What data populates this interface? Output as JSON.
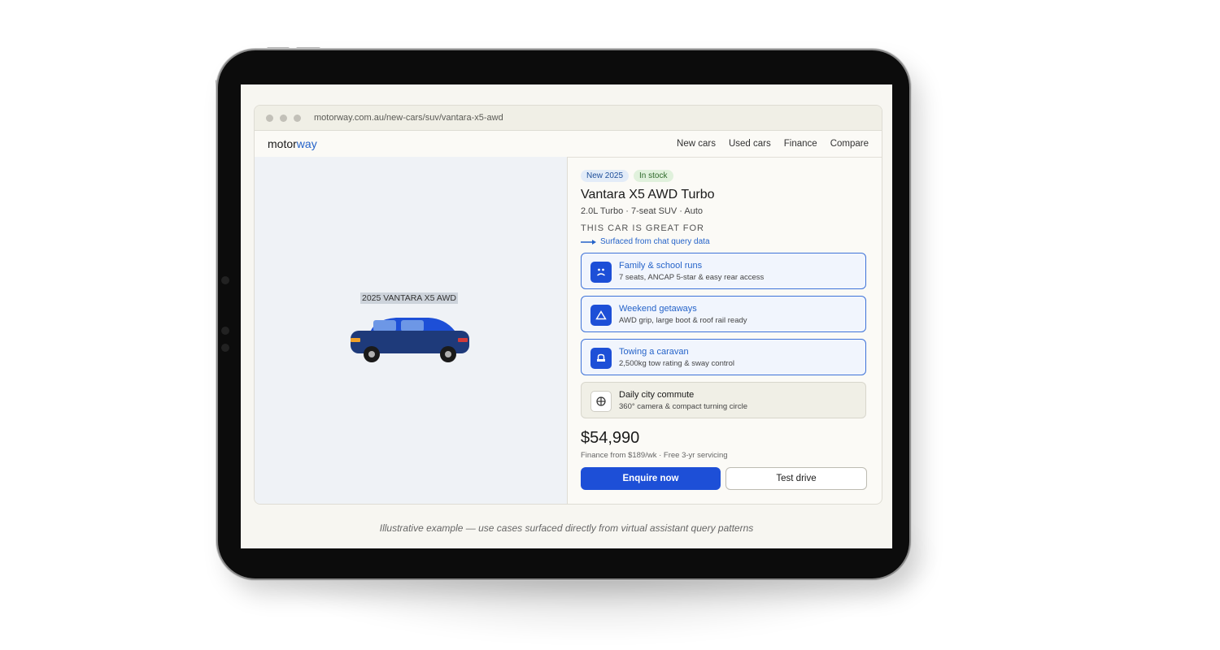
{
  "browser": {
    "url": "motorway.com.au/new-cars/suv/vantara-x5-awd"
  },
  "nav": {
    "logo_main": "motor",
    "logo_accent": "way",
    "links": [
      "New cars",
      "Used cars",
      "Finance",
      "Compare"
    ]
  },
  "hero": {
    "caption": "2025 VANTARA X5 AWD"
  },
  "listing": {
    "badges": [
      "New 2025",
      "In stock"
    ],
    "title": "Vantara X5 AWD Turbo",
    "subtitle": "2.0L Turbo · 7-seat SUV · Auto",
    "section_label": "THIS CAR IS GREAT FOR",
    "surfaced_note": "Surfaced from chat query data",
    "use_cases": [
      {
        "title": "Family & school runs",
        "desc": "7 seats, ANCAP 5-star & easy rear access",
        "icon": "family-icon",
        "highlighted": true
      },
      {
        "title": "Weekend getaways",
        "desc": "AWD grip, large boot & roof rail ready",
        "icon": "mountain-icon",
        "highlighted": true
      },
      {
        "title": "Towing a caravan",
        "desc": "2,500kg tow rating & sway control",
        "icon": "caravan-icon",
        "highlighted": true
      },
      {
        "title": "Daily city commute",
        "desc": "360° camera & compact turning circle",
        "icon": "crosshair-icon",
        "highlighted": false
      }
    ],
    "price": "$54,990",
    "finance": "Finance from $189/wk · Free 3-yr servicing",
    "enquire_label": "Enquire now",
    "test_drive_label": "Test drive"
  },
  "footnote": "Illustrative example — use cases surfaced directly from virtual assistant query patterns",
  "colors": {
    "accent": "#1d4fd7",
    "link": "#2563c9",
    "car_body": "#1e3a7a",
    "car_top": "#1d4fd7"
  }
}
